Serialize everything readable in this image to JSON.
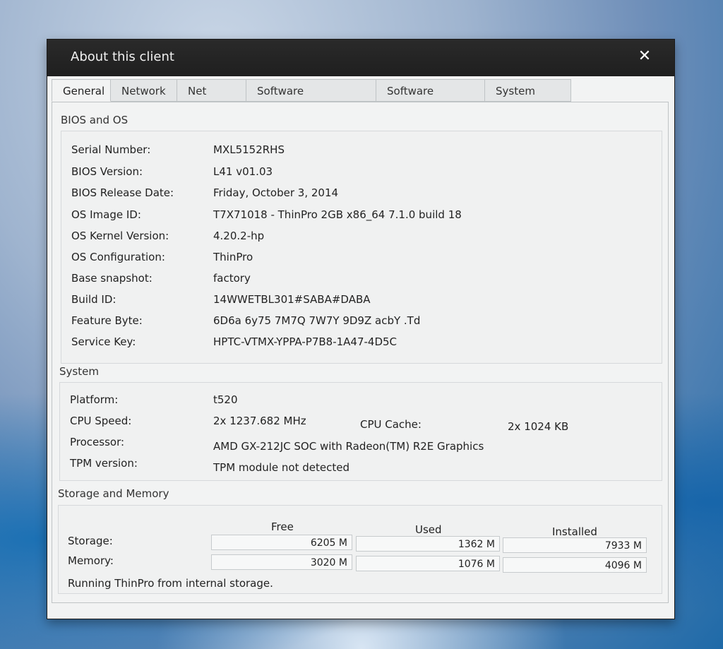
{
  "dialog": {
    "title": "About this client",
    "close_glyph": "✕"
  },
  "tabs": [
    {
      "label": "General",
      "active": true
    },
    {
      "label": "Network",
      "active": false
    },
    {
      "label": "Net Tools",
      "active": false
    },
    {
      "label": "Software Information",
      "active": false
    },
    {
      "label": "Software License",
      "active": false
    },
    {
      "label": "System Logs",
      "active": false
    }
  ],
  "bios_os": {
    "title": "BIOS and OS",
    "rows": [
      {
        "label": "Serial Number:",
        "value": "MXL5152RHS"
      },
      {
        "label": "BIOS Version:",
        "value": "L41 v01.03"
      },
      {
        "label": "BIOS Release Date:",
        "value": "Friday, October 3, 2014"
      },
      {
        "label": "OS Image ID:",
        "value": "T7X71018 - ThinPro 2GB x86_64 7.1.0 build 18"
      },
      {
        "label": "OS Kernel Version:",
        "value": "4.20.2-hp"
      },
      {
        "label": "OS Configuration:",
        "value": "ThinPro"
      },
      {
        "label": "Base snapshot:",
        "value": "factory"
      },
      {
        "label": "Build ID:",
        "value": "14WWETBL301#SABA#DABA"
      },
      {
        "label": "Feature Byte:",
        "value": "6D6a 6y75 7M7Q 7W7Y 9D9Z acbY .Td"
      },
      {
        "label": "Service Key:",
        "value": "HPTC-VTMX-YPPA-P7B8-1A47-4D5C"
      }
    ]
  },
  "system": {
    "title": "System",
    "platform_label": "Platform:",
    "platform_value": "t520",
    "cpu_speed_label": "CPU Speed:",
    "cpu_speed_value": "2x 1237.682 MHz",
    "cpu_cache_label": "CPU Cache:",
    "cpu_cache_value": "2x 1024 KB",
    "processor_label": "Processor:",
    "processor_value": "AMD GX-212JC SOC with Radeon(TM) R2E Graphics",
    "tpm_label": "TPM version:",
    "tpm_value": "TPM module not detected"
  },
  "storage_memory": {
    "title": "Storage and Memory",
    "headers": {
      "free": "Free",
      "used": "Used",
      "installed": "Installed"
    },
    "storage": {
      "label": "Storage:",
      "free": "6205 M",
      "used": "1362 M",
      "installed": "7933 M"
    },
    "memory": {
      "label": "Memory:",
      "free": "3020 M",
      "used": "1076 M",
      "installed": "4096 M"
    },
    "note": "Running ThinPro from internal storage."
  }
}
